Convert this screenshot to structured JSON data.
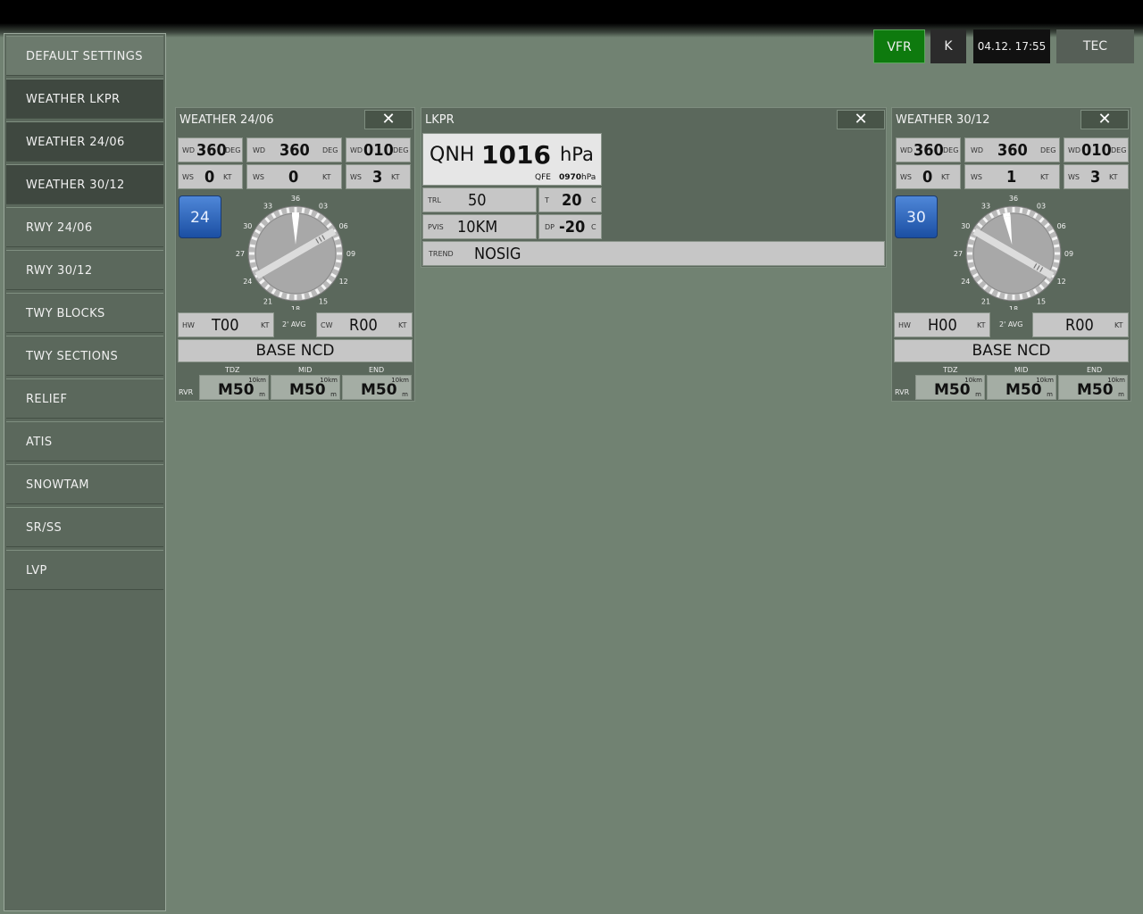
{
  "sidebar": {
    "items": [
      {
        "label": "DEFAULT SETTINGS"
      },
      {
        "label": "WEATHER LKPR"
      },
      {
        "label": "WEATHER 24/06"
      },
      {
        "label": "WEATHER 30/12"
      },
      {
        "label": "RWY 24/06"
      },
      {
        "label": "RWY 30/12"
      },
      {
        "label": "TWY BLOCKS"
      },
      {
        "label": "TWY SECTIONS"
      },
      {
        "label": "RELIEF"
      },
      {
        "label": "ATIS"
      },
      {
        "label": "SNOWTAM"
      },
      {
        "label": "SR/SS"
      },
      {
        "label": "LVP"
      }
    ]
  },
  "topbar": {
    "vfr": "VFR",
    "k": "K",
    "datetime": "04.12. 17:55",
    "tec": "TEC",
    "colors": {
      "vfr": "#0e7a0e",
      "dark": "#2b2b2b",
      "clock": "#111111"
    }
  },
  "weather_24_06": {
    "title": "WEATHER 24/06",
    "close": "✕",
    "wd1": {
      "label": "WD",
      "value": "360",
      "unit": "DEG"
    },
    "wd2": {
      "label": "WD",
      "value": "360",
      "unit": "DEG"
    },
    "wd3": {
      "label": "WD",
      "value": "010",
      "unit": "DEG"
    },
    "ws1": {
      "label": "WS",
      "value": "0",
      "unit": "KT"
    },
    "ws2": {
      "label": "WS",
      "value": "0",
      "unit": "KT"
    },
    "ws3": {
      "label": "WS",
      "value": "3",
      "unit": "KT"
    },
    "rwy_button": "24",
    "compass": {
      "ticks": [
        "36",
        "03",
        "06",
        "09",
        "12",
        "15",
        "18",
        "21",
        "24",
        "27",
        "30",
        "33"
      ],
      "runway_heading_deg": 240,
      "wind_deg": 360
    },
    "hw": {
      "label": "HW",
      "value": "T00",
      "unit": "KT"
    },
    "avg": "2' AVG",
    "cw": {
      "label": "CW",
      "value": "R00",
      "unit": "KT"
    },
    "base": "BASE NCD",
    "rvr": {
      "label": "RVR",
      "tdz": "TDZ",
      "mid": "MID",
      "end": "END",
      "values": [
        "M50",
        "M50",
        "M50"
      ],
      "sup": "10km",
      "unit": "m"
    }
  },
  "lkpr": {
    "title": "LKPR",
    "close": "✕",
    "qnh_label": "QNH",
    "qnh_value": "1016",
    "qnh_unit": "hPa",
    "qfe_label": "QFE",
    "qfe_value": "0970",
    "qfe_unit": "hPa",
    "trl_label": "TRL",
    "trl_value": "50",
    "t_label": "T",
    "t_value": "20",
    "t_unit": "C",
    "pvis_label": "PVIS",
    "pvis_value": "10KM",
    "dp_label": "DP",
    "dp_value": "-20",
    "dp_unit": "C",
    "trend_label": "TREND",
    "trend_value": "NOSIG"
  },
  "weather_30_12": {
    "title": "WEATHER 30/12",
    "close": "✕",
    "wd1": {
      "label": "WD",
      "value": "360",
      "unit": "DEG"
    },
    "wd2": {
      "label": "WD",
      "value": "360",
      "unit": "DEG"
    },
    "wd3": {
      "label": "WD",
      "value": "010",
      "unit": "DEG"
    },
    "ws1": {
      "label": "WS",
      "value": "0",
      "unit": "KT"
    },
    "ws2": {
      "label": "WS",
      "value": "1",
      "unit": "KT"
    },
    "ws3": {
      "label": "WS",
      "value": "3",
      "unit": "KT"
    },
    "rwy_button": "30",
    "compass": {
      "ticks": [
        "36",
        "03",
        "06",
        "09",
        "12",
        "15",
        "18",
        "21",
        "24",
        "27",
        "30",
        "33"
      ],
      "runway_heading_deg": 300,
      "wind_deg": 350
    },
    "hw": {
      "label": "HW",
      "value": "H00",
      "unit": "KT"
    },
    "avg": "2' AVG",
    "cw": {
      "label": "",
      "value": "R00",
      "unit": "KT"
    },
    "base": "BASE NCD",
    "rvr": {
      "label": "RVR",
      "tdz": "TDZ",
      "mid": "MID",
      "end": "END",
      "values": [
        "M50",
        "M50",
        "M50"
      ],
      "sup": "10km",
      "unit": "m"
    }
  }
}
